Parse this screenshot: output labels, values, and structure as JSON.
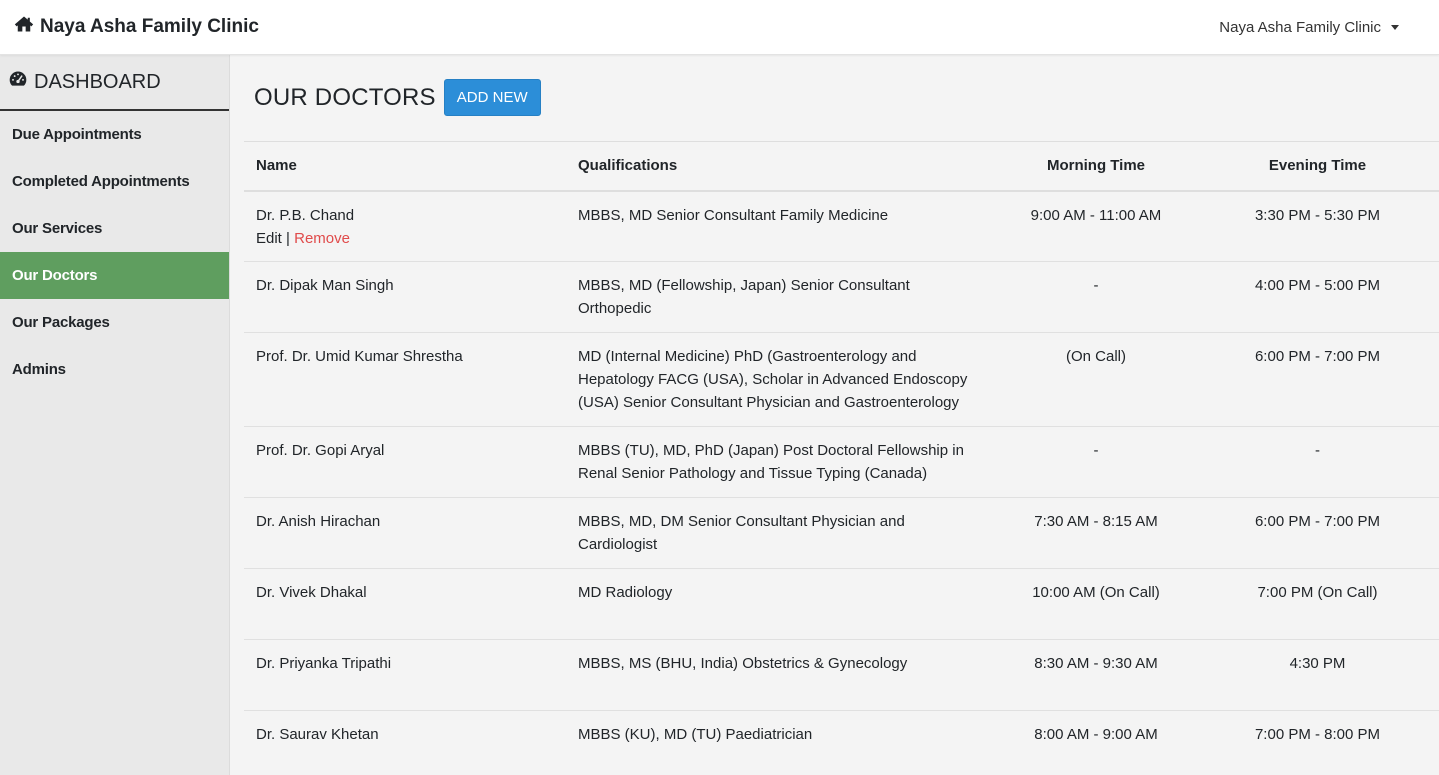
{
  "topbar": {
    "brand": "Naya Asha Family Clinic",
    "user_menu": "Naya Asha Family Clinic"
  },
  "sidebar": {
    "heading": "DASHBOARD",
    "items": [
      {
        "label": "Due Appointments"
      },
      {
        "label": "Completed Appointments"
      },
      {
        "label": "Our Services"
      },
      {
        "label": "Our Doctors",
        "active": true
      },
      {
        "label": "Our Packages"
      },
      {
        "label": "Admins"
      }
    ]
  },
  "main": {
    "title": "OUR DOCTORS",
    "add_button": "ADD NEW",
    "table": {
      "headers": [
        "Name",
        "Qualifications",
        "Morning Time",
        "Evening Time"
      ],
      "actions": {
        "edit": "Edit",
        "separator": "|",
        "remove": "Remove"
      },
      "rows": [
        {
          "name": "Dr. P.B. Chand",
          "qualifications": "MBBS, MD Senior Consultant Family Medicine",
          "morning": "9:00 AM - 11:00 AM",
          "evening": "3:30 PM - 5:30 PM"
        },
        {
          "name": "Dr. Dipak Man Singh",
          "qualifications": "MBBS, MD (Fellowship, Japan) Senior Consultant Orthopedic",
          "morning": "-",
          "evening": "4:00 PM - 5:00 PM"
        },
        {
          "name": "Prof. Dr. Umid Kumar Shrestha",
          "qualifications": "MD (Internal Medicine) PhD (Gastroenterology and Hepatology FACG (USA), Scholar in Advanced Endoscopy (USA) Senior Consultant Physician and Gastroenterology",
          "morning": "(On Call)",
          "evening": "6:00 PM - 7:00 PM"
        },
        {
          "name": "Prof. Dr. Gopi Aryal",
          "qualifications": "MBBS (TU), MD, PhD (Japan) Post Doctoral Fellowship in Renal Senior Pathology and Tissue Typing (Canada)",
          "morning": "-",
          "evening": "-"
        },
        {
          "name": "Dr. Anish Hirachan",
          "qualifications": "MBBS, MD, DM Senior Consultant Physician and Cardiologist",
          "morning": "7:30 AM - 8:15 AM",
          "evening": "6:00 PM - 7:00 PM"
        },
        {
          "name": "Dr. Vivek Dhakal",
          "qualifications": "MD Radiology",
          "morning": "10:00 AM (On Call)",
          "evening": "7:00 PM (On Call)"
        },
        {
          "name": "Dr. Priyanka Tripathi",
          "qualifications": "MBBS, MS (BHU, India) Obstetrics & Gynecology",
          "morning": "8:30 AM - 9:30 AM",
          "evening": "4:30 PM"
        },
        {
          "name": "Dr. Saurav Khetan",
          "qualifications": "MBBS (KU), MD (TU) Paediatrician",
          "morning": "8:00 AM - 9:00 AM",
          "evening": "7:00 PM - 8:00 PM"
        }
      ]
    }
  },
  "colors": {
    "accent_button": "#2c8ed8",
    "active_nav": "#5f9e5f",
    "remove_link": "#e04b4b"
  }
}
